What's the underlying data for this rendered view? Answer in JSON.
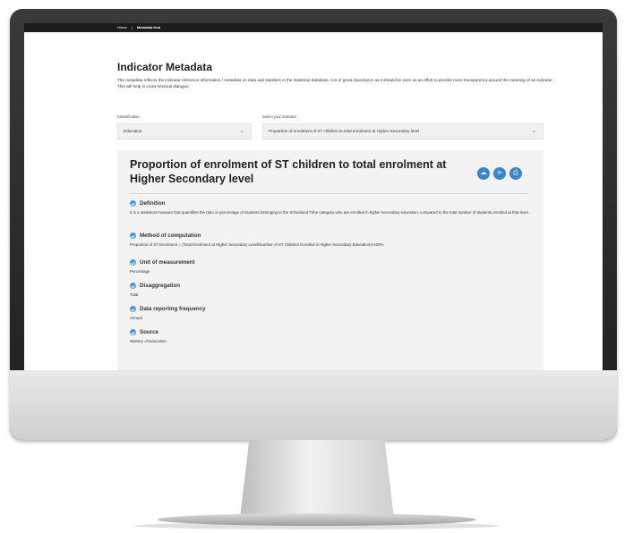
{
  "breadcrumb": {
    "home": "Home",
    "separator": "|",
    "current": "Metadata Hub"
  },
  "page": {
    "title": "Indicator Metadata",
    "intro": "The metadata reflects the indicator reference information / metadata on data and statistics in the statistical database. It is of great importance as it should be seen as an effort to provide more transparency around the meaning of an indicator. This will help in cross-sectoral dialogue."
  },
  "filters": {
    "classification_label": "Classification",
    "classification_value": "Education",
    "indicator_label": "Select your indicator",
    "indicator_value": "Proportion of enrolment of ST children to total enrolment at Higher Secondary level"
  },
  "icons": {
    "chevron": "chevron-down-icon",
    "download": "cloud-download-icon",
    "share": "share-icon",
    "print": "print-icon",
    "check": "check-circle-icon"
  },
  "colors": {
    "accent": "#3a86c8",
    "topbar": "#1b1b1b"
  },
  "indicator": {
    "title": "Proportion of enrolment of ST children to total enrolment at Higher Secondary level",
    "sections": {
      "definition": {
        "heading": "Definition",
        "body": "It is a statistical measure that quantifies the ratio or percentage of students belonging to the Scheduled Tribe category who are enrolled in higher secondary education, compared to the total number of students enrolled at that level."
      },
      "method": {
        "heading": "Method of computation",
        "body": "Proportion of ST Enrolment = (Total Enrolment at Higher Secondary Level/Number of ST Children Enrolled in Higher Secondary Education)×100%"
      },
      "unit": {
        "heading": "Unit of measurement",
        "body": "Percentage"
      },
      "disaggregation": {
        "heading": "Disaggregation",
        "body": "Total"
      },
      "frequency": {
        "heading": "Data reporting frequency",
        "body": "Annual"
      },
      "source": {
        "heading": "Source",
        "body": "Ministry of Education"
      }
    }
  }
}
